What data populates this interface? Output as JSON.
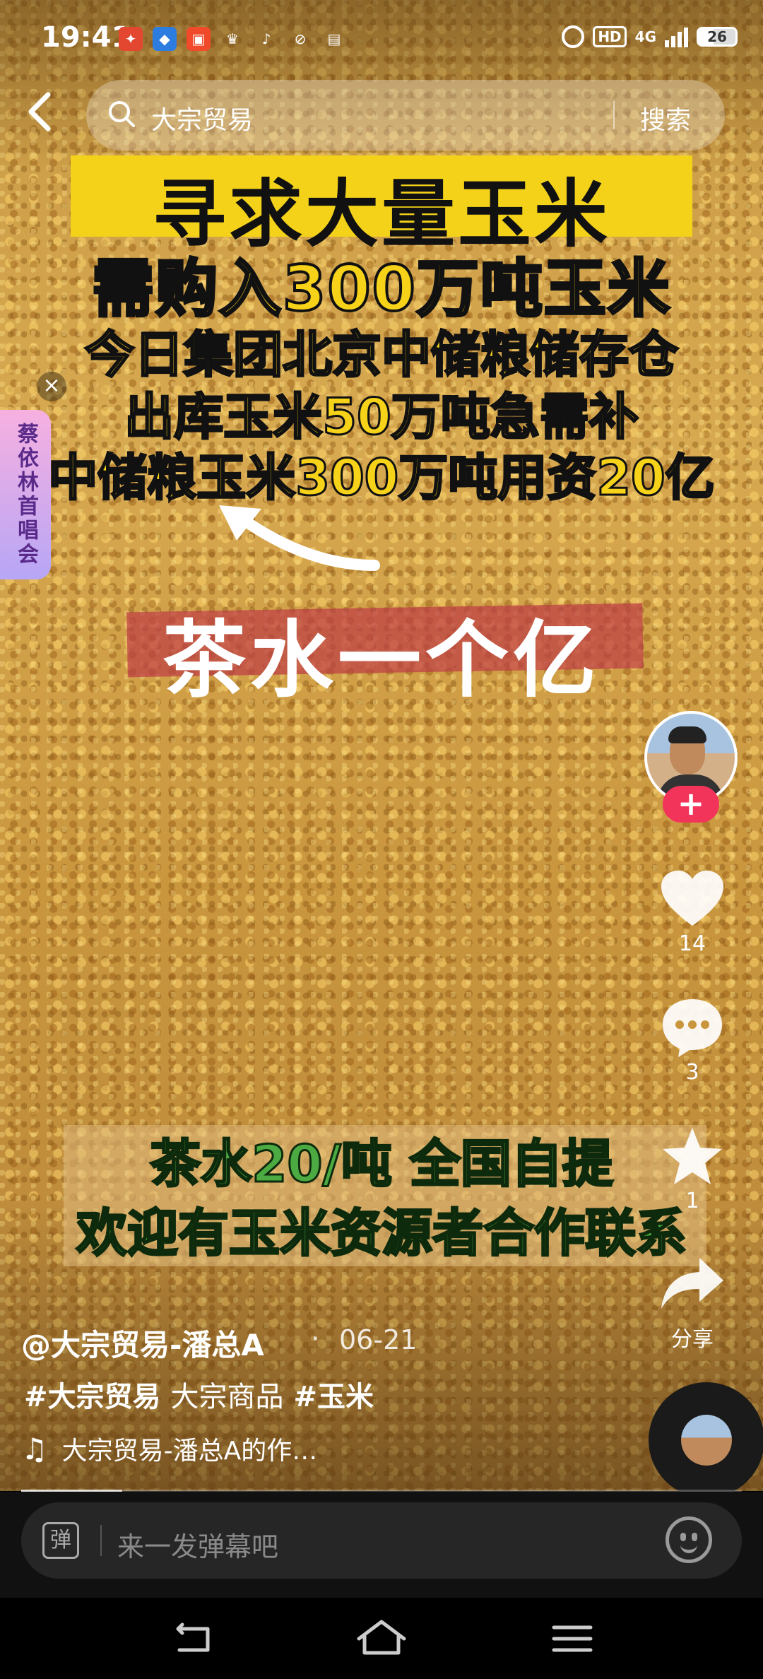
{
  "status_bar": {
    "time": "19:41",
    "net": "4G",
    "hd": "HD",
    "battery": "26"
  },
  "search": {
    "query": "大宗贸易",
    "button": "搜索"
  },
  "video_text": {
    "line1": "寻求大量玉米",
    "line2": "需购入300万吨玉米",
    "line3": "今日集团北京中储粮储存仓",
    "line4": "出库玉米50万吨急需补",
    "line5": "中储粮玉米300万吨用资20亿",
    "tea": "茶水一个亿",
    "bottom1": "茶水20/吨 全国自提",
    "bottom2": "欢迎有玉米资源者合作联系"
  },
  "side_ad": {
    "text": "蔡依林首唱会"
  },
  "actions": {
    "likes": "14",
    "comments": "3",
    "favorites": "1",
    "share": "分享"
  },
  "post": {
    "author": "@大宗贸易-潘总A",
    "date": "06-21",
    "tags": [
      "#大宗贸易",
      "大宗商品",
      "#玉米"
    ],
    "music": "大宗贸易-潘总A的作…"
  },
  "progress": 0.14,
  "danmaku": {
    "icon_label": "弹",
    "placeholder": "来一发弹幕吧"
  }
}
